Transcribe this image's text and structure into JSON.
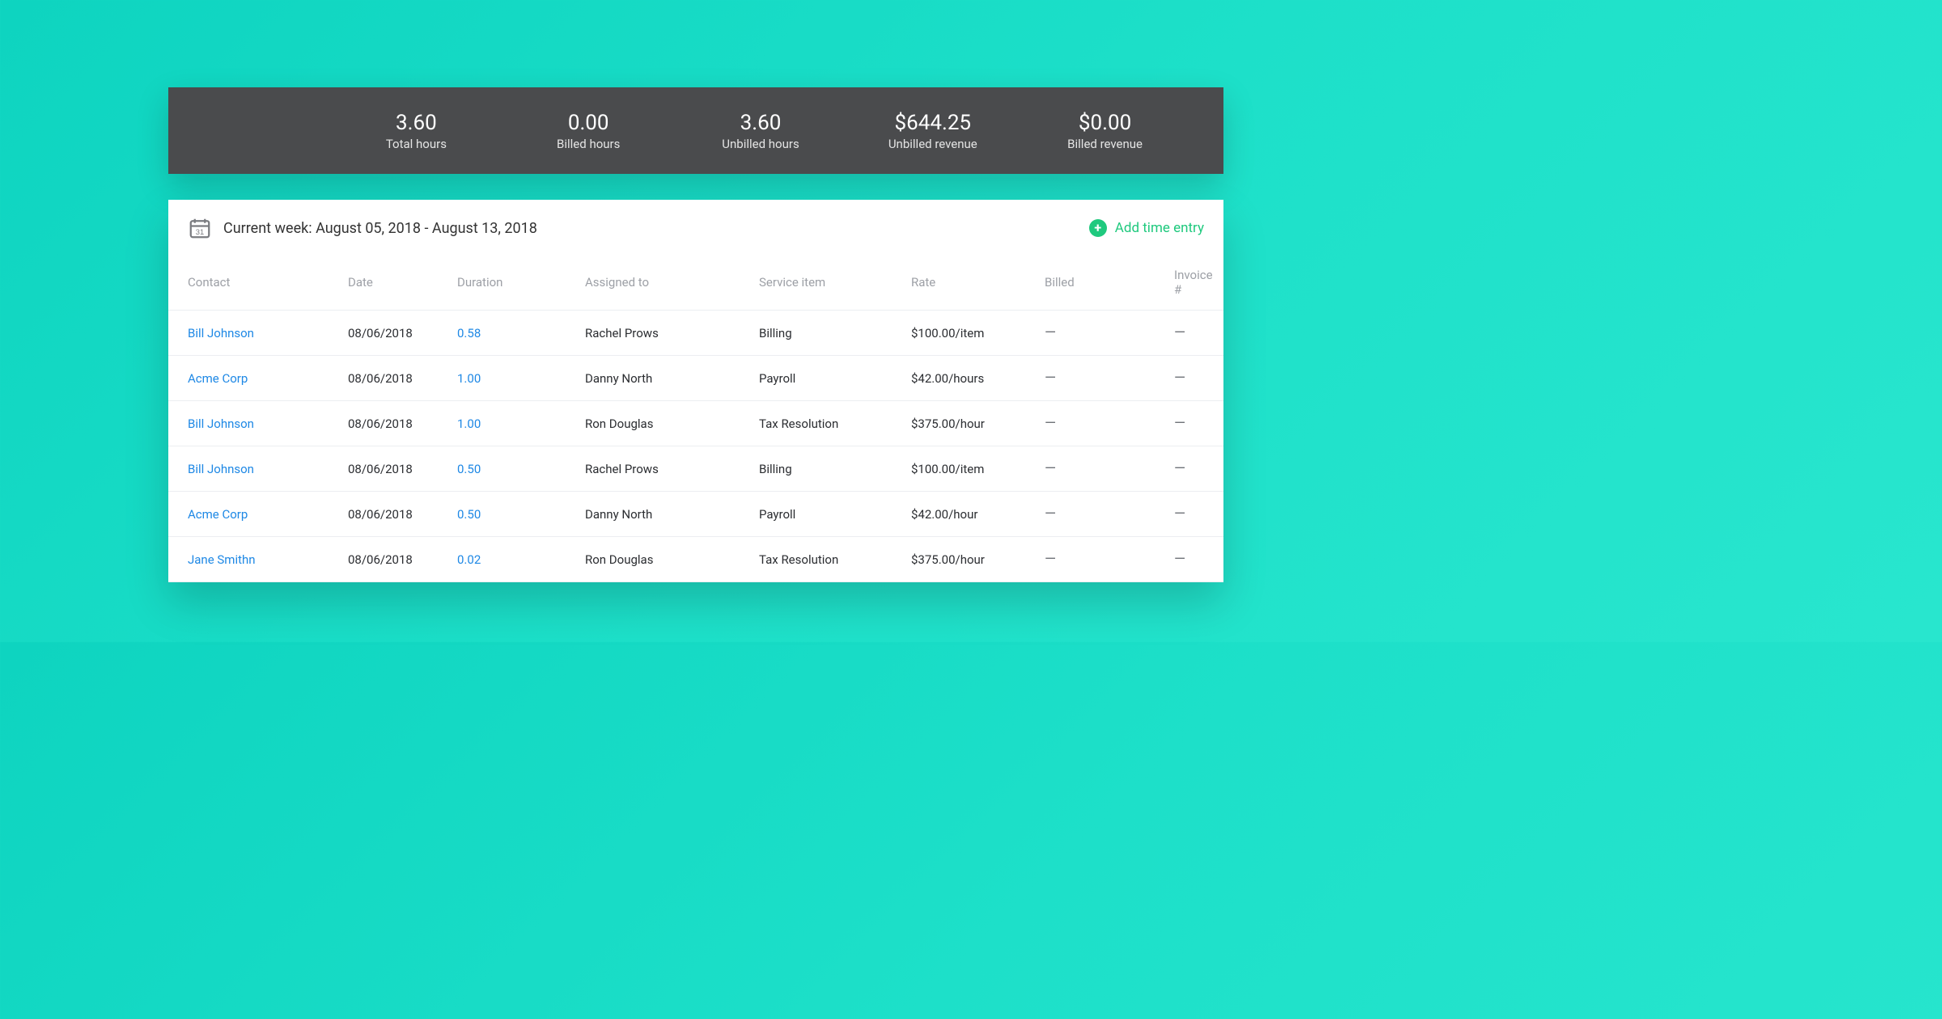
{
  "stats": [
    {
      "value": "3.60",
      "label": "Total hours"
    },
    {
      "value": "0.00",
      "label": "Billed hours"
    },
    {
      "value": "3.60",
      "label": "Unbilled hours"
    },
    {
      "value": "$644.25",
      "label": "Unbilled revenue"
    },
    {
      "value": "$0.00",
      "label": "Billed revenue"
    }
  ],
  "week_label": "Current week: August 05, 2018 - August 13, 2018",
  "add_entry_label": "Add time entry",
  "columns": {
    "contact": "Contact",
    "date": "Date",
    "duration": "Duration",
    "assigned_to": "Assigned to",
    "service_item": "Service item",
    "rate": "Rate",
    "billed": "Billed",
    "invoice": "Invoice #"
  },
  "rows": [
    {
      "contact": "Bill Johnson",
      "date": "08/06/2018",
      "duration": "0.58",
      "assigned_to": "Rachel Prows",
      "service_item": "Billing",
      "rate": "$100.00/item",
      "billed": "—",
      "invoice": "—"
    },
    {
      "contact": "Acme Corp",
      "date": "08/06/2018",
      "duration": "1.00",
      "assigned_to": "Danny North",
      "service_item": "Payroll",
      "rate": "$42.00/hours",
      "billed": "—",
      "invoice": "—"
    },
    {
      "contact": "Bill Johnson",
      "date": "08/06/2018",
      "duration": "1.00",
      "assigned_to": "Ron Douglas",
      "service_item": "Tax Resolution",
      "rate": "$375.00/hour",
      "billed": "—",
      "invoice": "—"
    },
    {
      "contact": "Bill Johnson",
      "date": "08/06/2018",
      "duration": "0.50",
      "assigned_to": "Rachel Prows",
      "service_item": "Billing",
      "rate": "$100.00/item",
      "billed": "—",
      "invoice": "—"
    },
    {
      "contact": "Acme Corp",
      "date": "08/06/2018",
      "duration": "0.50",
      "assigned_to": "Danny North",
      "service_item": "Payroll",
      "rate": "$42.00/hour",
      "billed": "—",
      "invoice": "—"
    },
    {
      "contact": "Jane Smithn",
      "date": "08/06/2018",
      "duration": "0.02",
      "assigned_to": "Ron Douglas",
      "service_item": "Tax Resolution",
      "rate": "$375.00/hour",
      "billed": "—",
      "invoice": "—"
    }
  ]
}
